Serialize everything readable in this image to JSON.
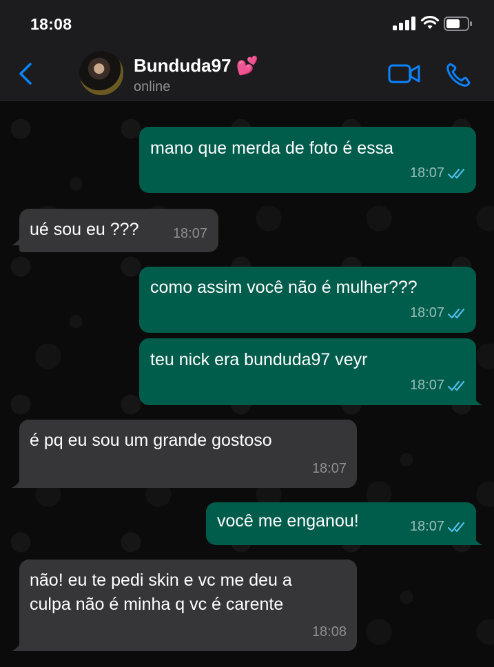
{
  "status_bar": {
    "time": "18:08"
  },
  "header": {
    "contact_name": "Bunduda97 💕",
    "contact_status": "online"
  },
  "icons": {
    "back": "chevron-left-icon",
    "video": "video-camera-icon",
    "call": "phone-icon",
    "read_receipt": "double-check-icon"
  },
  "colors": {
    "outgoing_bubble": "#005c4b",
    "incoming_bubble": "#363638",
    "accent": "#0a84ff",
    "read_tick": "#53bdeb"
  },
  "messages": [
    {
      "direction": "out",
      "text": "mano que merda de foto é essa",
      "time": "18:07"
    },
    {
      "direction": "in",
      "text": "ué sou eu ???",
      "time": "18:07"
    },
    {
      "direction": "out",
      "text": "como assim você não é mulher???",
      "time": "18:07"
    },
    {
      "direction": "out",
      "text": "teu nick era bunduda97 veyr",
      "time": "18:07"
    },
    {
      "direction": "in",
      "text": "é pq eu sou um grande gostoso",
      "time": "18:07"
    },
    {
      "direction": "out",
      "text": "você me enganou!",
      "time": "18:07"
    },
    {
      "direction": "in",
      "text": "não! eu te pedi skin e vc me deu a\nculpa não é minha q vc é carente",
      "time": "18:08"
    }
  ]
}
